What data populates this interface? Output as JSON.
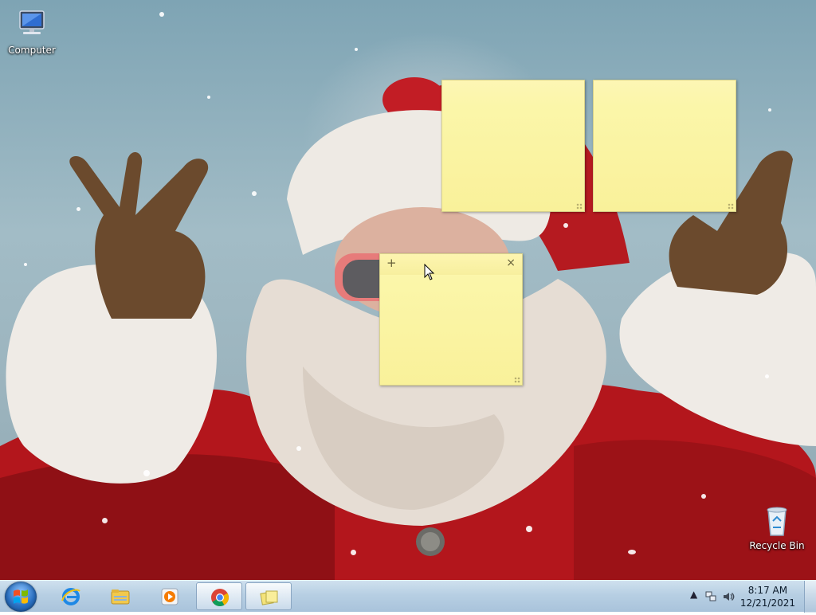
{
  "desktop": {
    "icons": [
      {
        "label": "Computer",
        "icon": "computer-icon"
      },
      {
        "label": "Recycle Bin",
        "icon": "recycle-bin-icon"
      }
    ]
  },
  "sticky_notes": [
    {
      "text": "",
      "toolbar": {
        "add": "+",
        "close": "×"
      }
    },
    {
      "text": ""
    },
    {
      "text": ""
    }
  ],
  "taskbar": {
    "start_icon": "windows-start-icon",
    "pinned": [
      {
        "app": "Internet Explorer",
        "icon": "internet-explorer-icon"
      },
      {
        "app": "Windows Explorer",
        "icon": "file-explorer-icon"
      },
      {
        "app": "Windows Media Player",
        "icon": "media-player-icon"
      },
      {
        "app": "Google Chrome",
        "icon": "chrome-icon"
      },
      {
        "app": "Sticky Notes",
        "icon": "sticky-notes-icon",
        "active": true
      }
    ],
    "tray": {
      "overflow": "▲",
      "clock_time": "8:17 AM",
      "clock_date": "12/21/2021"
    }
  },
  "colors": {
    "note_yellow": "#fbf6a9",
    "taskbar": "#b7cfe3",
    "santa_red": "#b3161c"
  }
}
